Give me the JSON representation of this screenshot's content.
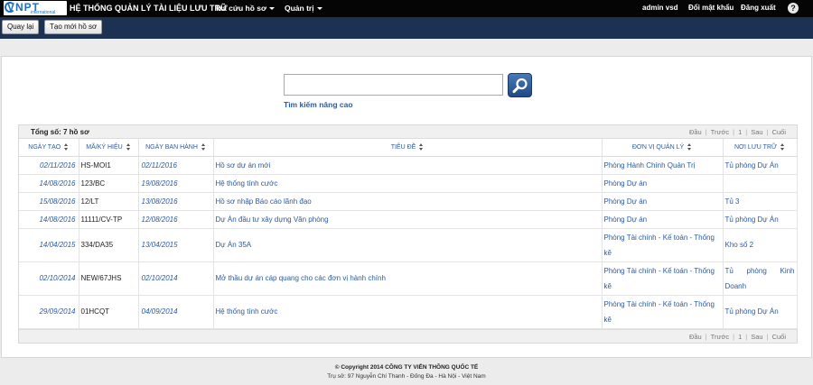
{
  "header": {
    "logo_text": "VNPT",
    "logo_sub": "international",
    "app_title": "HỆ THỐNG QUẢN LÝ TÀI LIỆU LƯU TRỮ",
    "menus": [
      "Tra cứu hồ sơ",
      "Quản trị"
    ],
    "user": "admin vsd",
    "change_password": "Đổi mật khẩu",
    "logout": "Đăng xuất",
    "help": "?"
  },
  "toolbar": {
    "back_label": "Quay lại",
    "create_label": "Tạo mới hồ sơ"
  },
  "search": {
    "value": "",
    "advanced_label": "Tìm kiếm nâng cao"
  },
  "grid": {
    "total": "Tổng số: 7 hồ sơ",
    "pager": {
      "first": "Đầu",
      "prev": "Trước",
      "page": "1",
      "next": "Sau",
      "last": "Cuối"
    },
    "columns": [
      "Ngày tạo",
      "Mã/Ký hiệu",
      "Ngày ban hành",
      "Tiêu đề",
      "Đơn vị quản lý",
      "Nơi lưu trữ"
    ],
    "rows": [
      {
        "created": "02/11/2016",
        "code": "HS-MOI1",
        "issued": "02/11/2016",
        "title": "Hồ sơ dự án mới",
        "unit": "Phòng Hành Chính Quản Trị",
        "location": "Tủ phòng Dự Án"
      },
      {
        "created": "14/08/2016",
        "code": "123/BC",
        "issued": "19/08/2016",
        "title": "Hệ thống tính cước",
        "unit": "Phòng Dự án",
        "location": ""
      },
      {
        "created": "15/08/2016",
        "code": "12/LT",
        "issued": "13/08/2016",
        "title": "Hồ sơ nhập Báo cáo lãnh đạo",
        "unit": "Phòng Dự án",
        "location": "Tủ 3"
      },
      {
        "created": "14/08/2016",
        "code": "11111/CV-TP",
        "issued": "12/08/2016",
        "title": "Dự Án đầu tư xây dựng Văn phòng",
        "unit": "Phòng Dự án",
        "location": "Tủ phòng Dự Án"
      },
      {
        "created": "14/04/2015",
        "code": "334/DA35",
        "issued": "13/04/2015",
        "title": "Dự Án 35A",
        "unit": "Phòng Tài chính - Kế toán - Thống kê",
        "location": "Kho số 2"
      },
      {
        "created": "02/10/2014",
        "code": "NEW/67JHS",
        "issued": "02/10/2014",
        "title": "Mở thầu dự án cáp quang cho các đơn vị hành chính",
        "unit": "Phòng Tài chính - Kế toán - Thống kê",
        "location": "Tủ phòng Kinh Doanh"
      },
      {
        "created": "29/09/2014",
        "code": "01HCQT",
        "issued": "04/09/2014",
        "title": "Hệ thống tính cước",
        "unit": "Phòng Tài chính - Kế toán - Thống kê",
        "location": "Tủ phòng Dự Án"
      }
    ]
  },
  "footer": {
    "copyright": "© Copyright 2014 CÔNG TY VIỄN THÔNG QUỐC TẾ",
    "address": "Trụ sở: 97 Nguyễn Chí Thanh - Đống Đa - Hà Nội - Việt Nam"
  }
}
